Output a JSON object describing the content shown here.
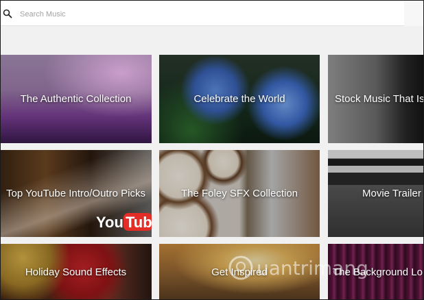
{
  "search": {
    "placeholder": "Search Music",
    "value": ""
  },
  "collections": [
    {
      "title": "The Authentic Collection"
    },
    {
      "title": "Celebrate the World"
    },
    {
      "title": "Stock Music That Is"
    },
    {
      "title": "Top YouTube Intro/Outro Picks"
    },
    {
      "title": "The Foley SFX Collection"
    },
    {
      "title": "Movie Trailer"
    },
    {
      "title": "Holiday Sound Effects"
    },
    {
      "title": "Get Inspired"
    },
    {
      "title": "The Background Lo"
    }
  ],
  "watermark": {
    "text": "uantrimang"
  }
}
